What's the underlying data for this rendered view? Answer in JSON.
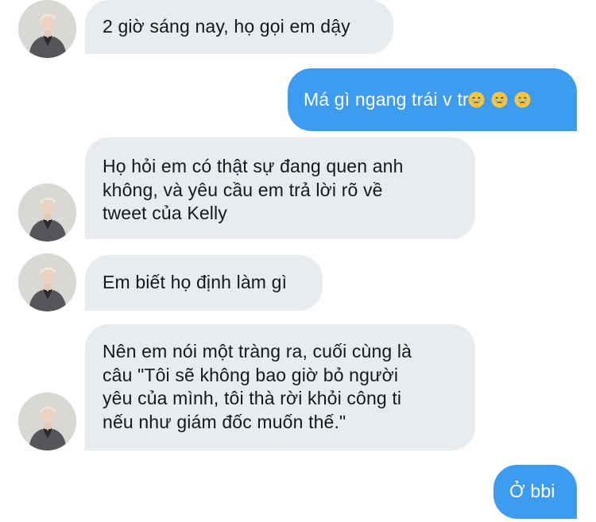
{
  "conversation": {
    "messages": [
      {
        "direction": "incoming",
        "text": "2 giờ sáng nay, họ gọi em dậy"
      },
      {
        "direction": "outgoing",
        "text": "Má gì ngang trái v tr",
        "emojis": [
          "face-holding-back-tears",
          "face-holding-back-tears",
          "face-holding-back-tears"
        ]
      },
      {
        "direction": "incoming",
        "text": "Họ hỏi em có thật sự đang quen anh\nkhông, và yêu cầu em trả lời rõ về\ntweet của Kelly"
      },
      {
        "direction": "incoming",
        "text": "Em biết họ định làm gì"
      },
      {
        "direction": "incoming",
        "text": "Nên em nói một tràng ra, cuối cùng là\ncâu \"Tôi sẽ không bao giờ bỏ người\nyêu của mình, tôi thà rời khỏi công ti\nnếu như giám đốc muốn thế.\""
      },
      {
        "direction": "outgoing",
        "text": "Ở bbi"
      }
    ]
  },
  "colors": {
    "incoming_bubble": "#e8ebef",
    "incoming_text": "#16191c",
    "outgoing_bubble": "#3d9bf0",
    "outgoing_text": "#ffffff",
    "background": "#ffffff"
  }
}
